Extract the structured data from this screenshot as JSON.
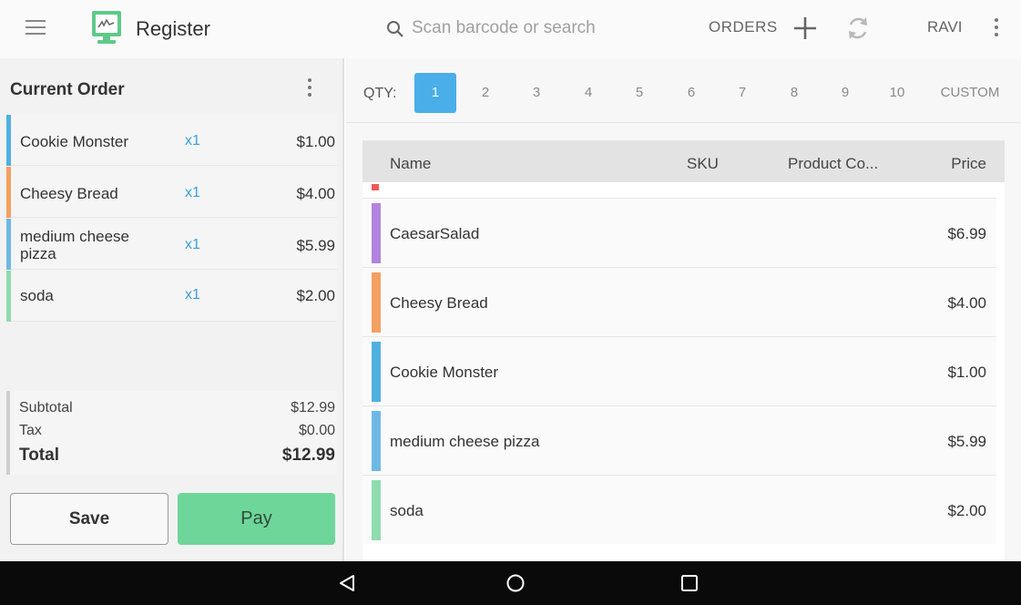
{
  "header": {
    "title": "Register",
    "search_placeholder": "Scan barcode or search",
    "orders_label": "ORDERS",
    "user_label": "RAVI",
    "icons": [
      "menu-icon",
      "register-logo-icon",
      "search-icon",
      "add-icon",
      "sync-icon",
      "more-vert-icon"
    ]
  },
  "order": {
    "title": "Current Order",
    "items": [
      {
        "name": "Cookie Monster",
        "qty": "x1",
        "price": "$1.00",
        "color": "#4fb0e0"
      },
      {
        "name": "Cheesy Bread",
        "qty": "x1",
        "price": "$4.00",
        "color": "#f4a062"
      },
      {
        "name": "medium cheese pizza",
        "qty": "x1",
        "price": "$5.99",
        "color": "#6fb8e6"
      },
      {
        "name": "soda",
        "qty": "x1",
        "price": "$2.00",
        "color": "#8fdcae"
      }
    ],
    "subtotal_label": "Subtotal",
    "subtotal_value": "$12.99",
    "tax_label": "Tax",
    "tax_value": "$0.00",
    "total_label": "Total",
    "total_value": "$12.99",
    "save_label": "Save",
    "pay_label": "Pay"
  },
  "qty_bar": {
    "label": "QTY:",
    "options": [
      "1",
      "2",
      "3",
      "4",
      "5",
      "6",
      "7",
      "8",
      "9",
      "10",
      "CUSTOM"
    ],
    "selected": "1"
  },
  "products": {
    "columns": [
      "Name",
      "SKU",
      "Product Co...",
      "Price"
    ],
    "rows": [
      {
        "name": "CaesarSalad",
        "price": "$6.99",
        "color": "#b283e0"
      },
      {
        "name": "Cheesy Bread",
        "price": "$4.00",
        "color": "#f4a062"
      },
      {
        "name": "Cookie Monster",
        "price": "$1.00",
        "color": "#4fb0e0"
      },
      {
        "name": "medium cheese pizza",
        "price": "$5.99",
        "color": "#6fb8e6"
      },
      {
        "name": "soda",
        "price": "$2.00",
        "color": "#8fdcae"
      }
    ]
  },
  "colors": {
    "accent": "#4aaee8",
    "pay": "#6fd69a",
    "partial_row_marker": "#f05a5a"
  },
  "navbar": {
    "icons": [
      "back-icon",
      "home-icon",
      "recents-icon"
    ]
  }
}
